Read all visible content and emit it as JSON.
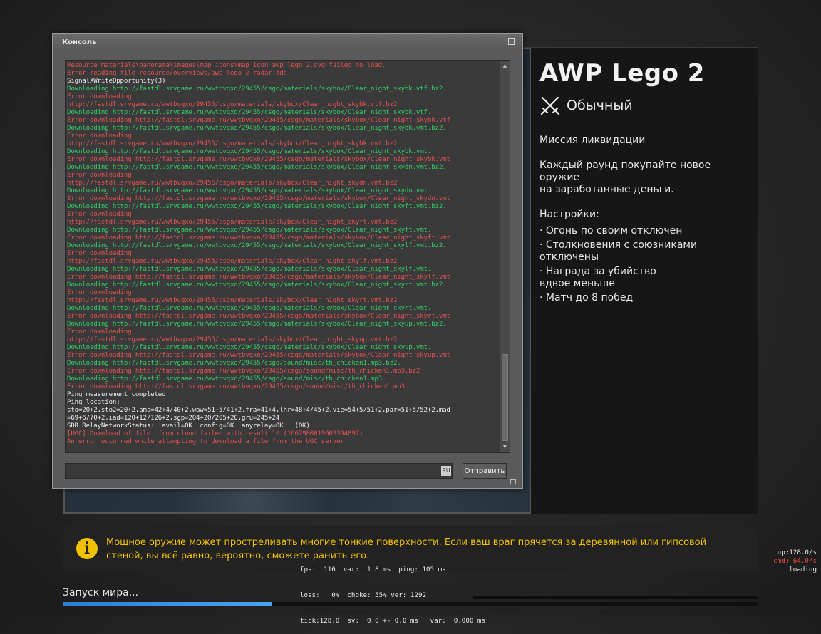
{
  "map": {
    "title": "AWP Lego 2",
    "mode": "Обычный",
    "mission": "Миссия ликвидации",
    "description": [
      "Каждый раунд покупайте новое",
      "оружие",
      "на заработанные деньги."
    ],
    "settings_title": "Настройки:",
    "settings": [
      "· Огонь по своим отключен",
      "· Столкновения с союзниками",
      "отключены",
      "· Награда за убийство",
      "вдвое меньше",
      "· Матч до 8 побед"
    ]
  },
  "console": {
    "title": "Консоль",
    "close_symbol": "▫",
    "input_value": "",
    "lang": "RU",
    "send_label": "Отправить",
    "lines": [
      {
        "c": "err",
        "t": "Resource materials\\panorama\\images\\map_icons\\map_icon_awp_lego_2.svg failed to load."
      },
      {
        "c": "err",
        "t": "Error reading file resource/overviews/awp_lego_2_radar.dds."
      },
      {
        "c": "ok",
        "t": "SignalXWriteOpportunity(3)"
      },
      {
        "c": "dl",
        "t": "Downloading http://fastdl.srvgame.ru/wwtbvqxo/29455/csgo/materials/skybox/Clear_night_skybk.vtf.bz2."
      },
      {
        "c": "err",
        "t": "Error downloading"
      },
      {
        "c": "err",
        "t": "http://fastdl.srvgame.ru/wwtbvqxo/29455/csgo/materials/skybox/Clear_night_skybk.vtf.bz2"
      },
      {
        "c": "dl",
        "t": "Downloading http://fastdl.srvgame.ru/wwtbvqxo/29455/csgo/materials/skybox/Clear_night_skybk.vtf."
      },
      {
        "c": "err",
        "t": "Error downloading http://fastdl.srvgame.ru/wwtbvqxo/29455/csgo/materials/skybox/Clear_night_skybk.vtf"
      },
      {
        "c": "dl",
        "t": "Downloading http://fastdl.srvgame.ru/wwtbvqxo/29455/csgo/materials/skybox/Clear_night_skybk.vmt.bz2."
      },
      {
        "c": "err",
        "t": "Error downloading"
      },
      {
        "c": "err",
        "t": "http://fastdl.srvgame.ru/wwtbvqxo/29455/csgo/materials/skybox/Clear_night_skybk.vmt.bz2"
      },
      {
        "c": "dl",
        "t": "Downloading http://fastdl.srvgame.ru/wwtbvqxo/29455/csgo/materials/skybox/Clear_night_skybk.vmt."
      },
      {
        "c": "err",
        "t": "Error downloading http://fastdl.srvgame.ru/wwtbvqxo/29455/csgo/materials/skybox/Clear_night_skybk.vmt"
      },
      {
        "c": "dl",
        "t": "Downloading http://fastdl.srvgame.ru/wwtbvqxo/29455/csgo/materials/skybox/Clear_night_skydn.vmt.bz2."
      },
      {
        "c": "err",
        "t": "Error downloading"
      },
      {
        "c": "err",
        "t": "http://fastdl.srvgame.ru/wwtbvqxo/29455/csgo/materials/skybox/Clear_night_skydn.vmt.bz2"
      },
      {
        "c": "dl",
        "t": "Downloading http://fastdl.srvgame.ru/wwtbvqxo/29455/csgo/materials/skybox/Clear_night_skydn.vmt."
      },
      {
        "c": "err",
        "t": "Error downloading http://fastdl.srvgame.ru/wwtbvqxo/29455/csgo/materials/skybox/Clear_night_skydn.vmt"
      },
      {
        "c": "dl",
        "t": "Downloading http://fastdl.srvgame.ru/wwtbvqxo/29455/csgo/materials/skybox/Clear_night_skyft.vmt.bz2."
      },
      {
        "c": "err",
        "t": "Error downloading"
      },
      {
        "c": "err",
        "t": "http://fastdl.srvgame.ru/wwtbvqxo/29455/csgo/materials/skybox/Clear_night_skyft.vmt.bz2"
      },
      {
        "c": "dl",
        "t": "Downloading http://fastdl.srvgame.ru/wwtbvqxo/29455/csgo/materials/skybox/Clear_night_skyft.vmt."
      },
      {
        "c": "err",
        "t": "Error downloading http://fastdl.srvgame.ru/wwtbvqxo/29455/csgo/materials/skybox/Clear_night_skyft.vmt"
      },
      {
        "c": "dl",
        "t": "Downloading http://fastdl.srvgame.ru/wwtbvqxo/29455/csgo/materials/skybox/Clear_night_skylf.vmt.bz2."
      },
      {
        "c": "err",
        "t": "Error downloading"
      },
      {
        "c": "err",
        "t": "http://fastdl.srvgame.ru/wwtbvqxo/29455/csgo/materials/skybox/Clear_night_skylf.vmt.bz2"
      },
      {
        "c": "dl",
        "t": "Downloading http://fastdl.srvgame.ru/wwtbvqxo/29455/csgo/materials/skybox/Clear_night_skylf.vmt."
      },
      {
        "c": "err",
        "t": "Error downloading http://fastdl.srvgame.ru/wwtbvqxo/29455/csgo/materials/skybox/Clear_night_skylf.vmt"
      },
      {
        "c": "dl",
        "t": "Downloading http://fastdl.srvgame.ru/wwtbvqxo/29455/csgo/materials/skybox/Clear_night_skyrt.vmt.bz2."
      },
      {
        "c": "err",
        "t": "Error downloading"
      },
      {
        "c": "err",
        "t": "http://fastdl.srvgame.ru/wwtbvqxo/29455/csgo/materials/skybox/Clear_night_skyrt.vmt.bz2"
      },
      {
        "c": "dl",
        "t": "Downloading http://fastdl.srvgame.ru/wwtbvqxo/29455/csgo/materials/skybox/Clear_night_skyrt.vmt."
      },
      {
        "c": "err",
        "t": "Error downloading http://fastdl.srvgame.ru/wwtbvqxo/29455/csgo/materials/skybox/Clear_night_skyrt.vmt"
      },
      {
        "c": "dl",
        "t": "Downloading http://fastdl.srvgame.ru/wwtbvqxo/29455/csgo/materials/skybox/Clear_night_skyup.vmt.bz2."
      },
      {
        "c": "err",
        "t": "Error downloading"
      },
      {
        "c": "err",
        "t": "http://fastdl.srvgame.ru/wwtbvqxo/29455/csgo/materials/skybox/Clear_night_skyup.vmt.bz2"
      },
      {
        "c": "dl",
        "t": "Downloading http://fastdl.srvgame.ru/wwtbvqxo/29455/csgo/materials/skybox/Clear_night_skyup.vmt."
      },
      {
        "c": "err",
        "t": "Error downloading http://fastdl.srvgame.ru/wwtbvqxo/29455/csgo/materials/skybox/Clear_night_skyup.vmt"
      },
      {
        "c": "dl",
        "t": "Downloading http://fastdl.srvgame.ru/wwtbvqxo/29455/csgo/sound/misc/th_chicken1.mp3.bz2."
      },
      {
        "c": "err",
        "t": "Error downloading http://fastdl.srvgame.ru/wwtbvqxo/29455/csgo/sound/misc/th_chicken1.mp3.bz2"
      },
      {
        "c": "dl",
        "t": "Downloading http://fastdl.srvgame.ru/wwtbvqxo/29455/csgo/sound/misc/th_chicken1.mp3."
      },
      {
        "c": "err",
        "t": "Error downloading http://fastdl.srvgame.ru/wwtbvqxo/29455/csgo/sound/misc/th_chicken1.mp3"
      },
      {
        "c": "ok",
        "t": "Ping measurement completed"
      },
      {
        "c": "ok",
        "t": "Ping location:"
      },
      {
        "c": "ok",
        "t": "sto=20+2,sto2=20+2,ams=42+4/40+2,waw=51+5/41+2,fra=41+4,lhr=48+4/45+2,vie=54+5/51+2,par=51+5/52+2,mad"
      },
      {
        "c": "ok",
        "t": "=69+6/70+2,iad=120+12/126+2,sgp=204+20/205+20,gru=245+24"
      },
      {
        "c": "ok",
        "t": "SDR RelayNetworkStatus:  avail=OK  config=OK  anyrelay=OK   (OK)"
      },
      {
        "c": "err",
        "t": "[UGC] Download of file  from cloud failed with result 16 (1667980019603394897)"
      },
      {
        "c": "err",
        "t": "An error occurred while attempting to download a file from the UGC server!"
      }
    ]
  },
  "tip": {
    "icon": "i",
    "line1": "Мощное оружие может простреливать многие тонкие поверхности. Если ваш враг прячется за деревянной или гипсовой",
    "line2": "стеной, вы всё равно, вероятно, сможете ранить его."
  },
  "netgraph": {
    "line1": "fps:  116  var:  1.8 ms  ping: 105 ms",
    "line2": "loss:   0%  choke: 55% ver: 1292",
    "line3": "tick:128.0  sv:  0.0 +- 0.0 ms   var:  0.000 ms",
    "up": "up:128.0/s",
    "cmd": "cmd: 64.0/s",
    "status": "loading"
  },
  "loading": {
    "label": "Запуск мира...",
    "progress": 0.3
  },
  "colors": {
    "error": "#e35151",
    "download": "#33cc66",
    "tip": "#f2c100",
    "progress": "#2a7fd4"
  }
}
